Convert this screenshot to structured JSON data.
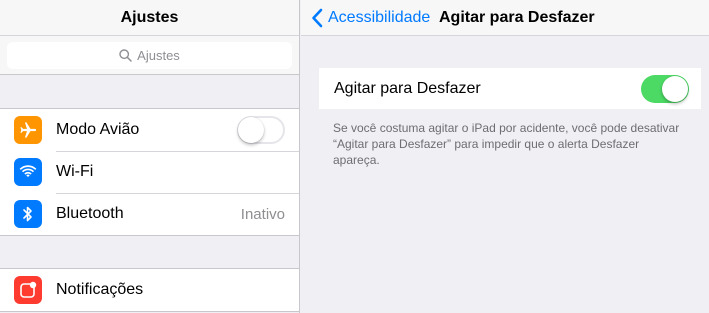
{
  "left": {
    "title": "Ajustes",
    "search": {
      "placeholder": "Ajustes"
    },
    "group1": [
      {
        "label": "Modo Avião",
        "icon": "airplane-icon",
        "icon_bg": "#ff9500",
        "toggle": "off"
      },
      {
        "label": "Wi-Fi",
        "icon": "wifi-icon",
        "icon_bg": "#007aff",
        "value": ""
      },
      {
        "label": "Bluetooth",
        "icon": "bluetooth-icon",
        "icon_bg": "#007aff",
        "value": "Inativo"
      }
    ],
    "group2": [
      {
        "label": "Notificações",
        "icon": "notifications-icon",
        "icon_bg": "#ff3b30"
      }
    ]
  },
  "right": {
    "back_label": "Acessibilidade",
    "title": "Agitar para Desfazer",
    "setting": {
      "label": "Agitar para Desfazer",
      "toggle": "on"
    },
    "footnote": "Se você costuma agitar o iPad por acidente, você pode desativar “Agitar para Desfazer” para impedir que o alerta Desfazer apareça."
  },
  "colors": {
    "accent": "#007aff",
    "toggle_on": "#4cd964",
    "background": "#efeff4"
  }
}
